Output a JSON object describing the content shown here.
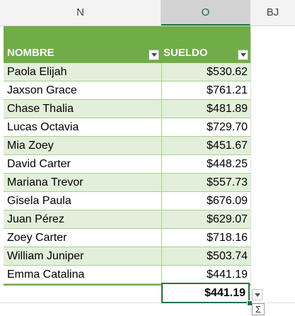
{
  "column_headers": [
    "N",
    "O",
    "BJ"
  ],
  "table": {
    "headers": {
      "name": "NOMBRE",
      "salary": "SUELDO"
    },
    "rows": [
      {
        "name": "Paola Elijah",
        "salary": "$530.62"
      },
      {
        "name": "Jaxson Grace",
        "salary": "$761.21"
      },
      {
        "name": "Chase Thalia",
        "salary": "$481.89"
      },
      {
        "name": "Lucas Octavia",
        "salary": "$729.70"
      },
      {
        "name": "Mia Zoey",
        "salary": "$451.67"
      },
      {
        "name": "David Carter",
        "salary": "$448.25"
      },
      {
        "name": "Mariana Trevor",
        "salary": "$557.73"
      },
      {
        "name": "Gisela Paula",
        "salary": "$676.09"
      },
      {
        "name": "Juan Pérez",
        "salary": "$629.07"
      },
      {
        "name": "Zoey Carter",
        "salary": "$718.16"
      },
      {
        "name": "William Juniper",
        "salary": "$503.74"
      },
      {
        "name": "Emma Catalina",
        "salary": "$441.19"
      }
    ],
    "total": {
      "salary": "$441.19"
    }
  },
  "icons": {
    "filter": "filter-dropdown-icon",
    "total_dropdown": "chevron-down-icon",
    "sum": "sigma-icon"
  },
  "sum_glyph": "Σ",
  "colors": {
    "table_header": "#70ad47",
    "band": "#e2efda",
    "border": "#a9d08e",
    "selection": "#217346"
  }
}
